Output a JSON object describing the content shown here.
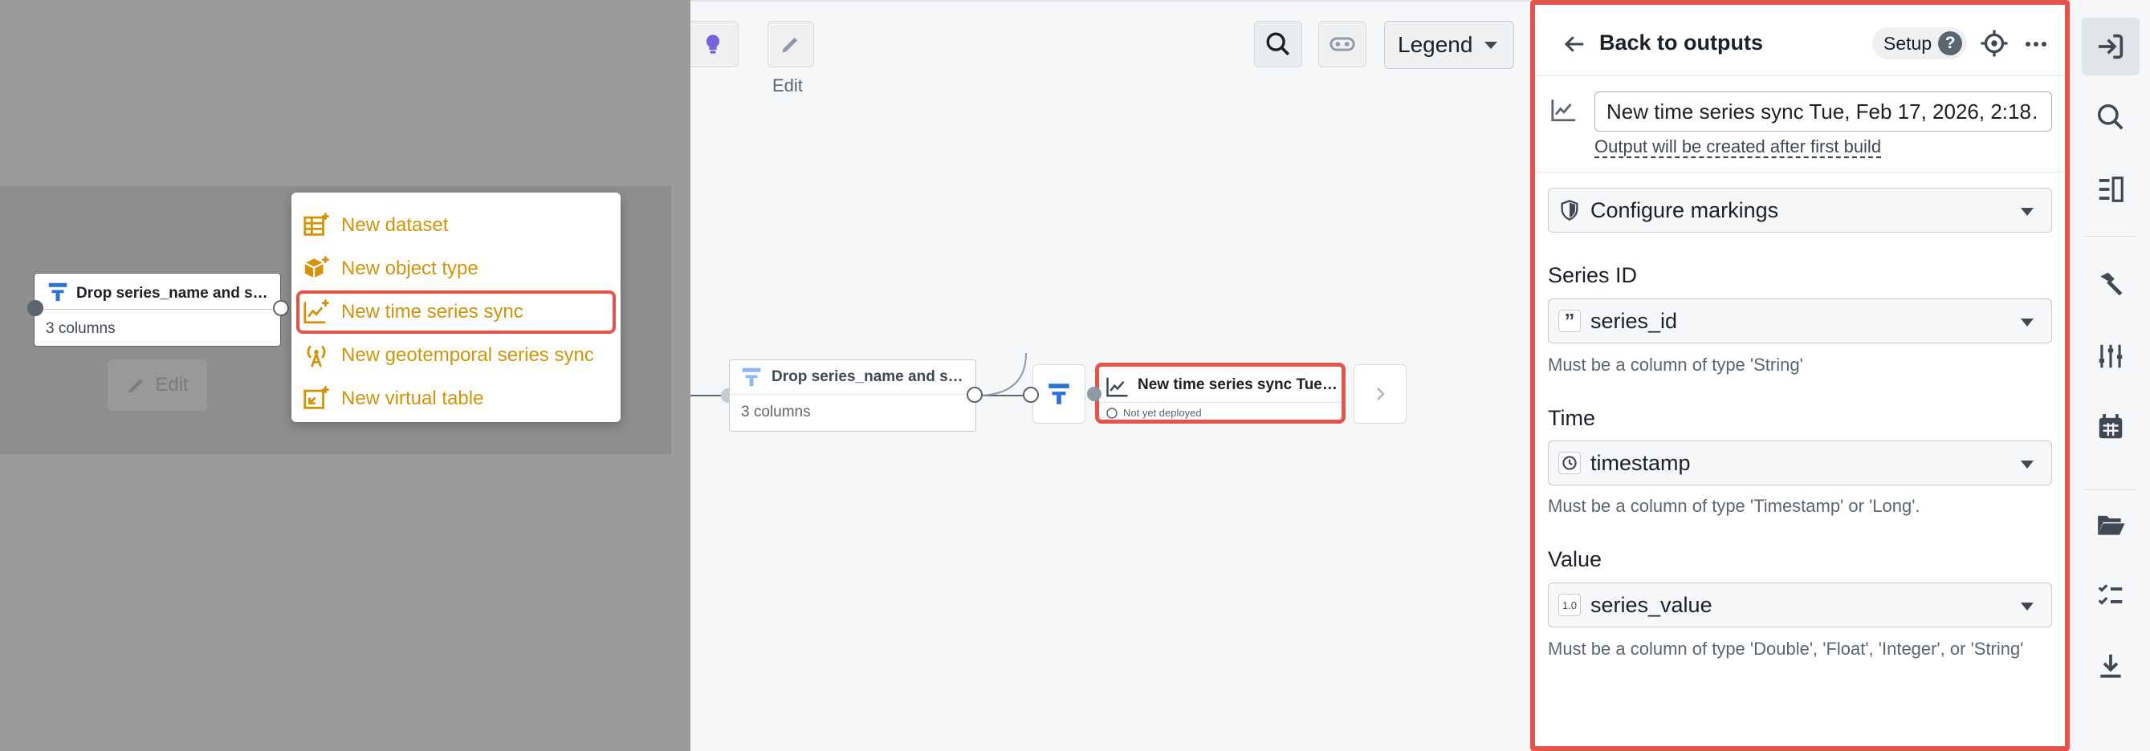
{
  "left_overlay": {
    "node": {
      "title": "Drop series_name and s…",
      "subtitle": "3 columns"
    },
    "edit_label": "Edit",
    "menu": [
      {
        "label": "New dataset",
        "icon": "dataset-add-icon"
      },
      {
        "label": "New object type",
        "icon": "cube-add-icon"
      },
      {
        "label": "New time series sync",
        "icon": "timeseries-add-icon"
      },
      {
        "label": "New geotemporal series sync",
        "icon": "antenna-icon"
      },
      {
        "label": "New virtual table",
        "icon": "virtual-table-icon"
      }
    ],
    "highlighted_index": 2
  },
  "toolbar": {
    "edit_label": "Edit",
    "legend_label": "Legend"
  },
  "graph": {
    "drop_node": {
      "title": "Drop series_name and s…",
      "subtitle": "3 columns"
    },
    "ts_node": {
      "title": "New time series sync Tue…",
      "status": "Not yet deployed"
    }
  },
  "panel": {
    "back_label": "Back to outputs",
    "setup_label": "Setup",
    "name_value": "New time series sync Tue, Feb 17, 2026, 2:18…",
    "hint": "Output will be created after first build",
    "markings_label": "Configure markings",
    "fields": [
      {
        "label": "Series ID",
        "value": "series_id",
        "help": "Must be a column of type 'String'"
      },
      {
        "label": "Time",
        "value": "timestamp",
        "help": "Must be a column of type 'Timestamp' or 'Long'."
      },
      {
        "label": "Value",
        "value": "series_value",
        "help": "Must be a column of type 'Double', 'Float', 'Integer', or 'String'"
      }
    ]
  },
  "colors": {
    "menu_text": "#d4940a",
    "highlight": "#e5534b",
    "accent_blue": "#2d72d2"
  }
}
